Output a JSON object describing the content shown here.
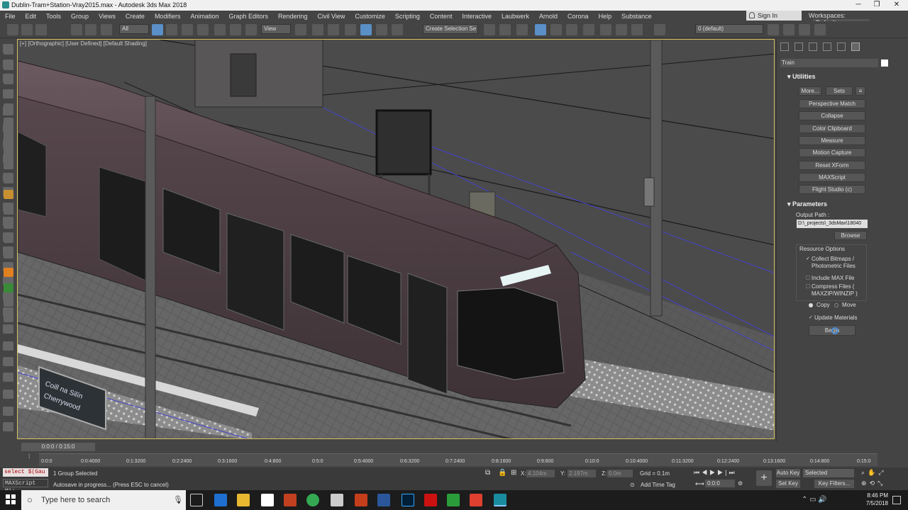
{
  "title": "Dublin-Tram+Station-Vray2015.max - Autodesk 3ds Max 2018",
  "menu": [
    "File",
    "Edit",
    "Tools",
    "Group",
    "Views",
    "Create",
    "Modifiers",
    "Animation",
    "Graph Editors",
    "Rendering",
    "Civil View",
    "Customize",
    "Scripting",
    "Content",
    "Interactive",
    "Laubwerk",
    "Arnold",
    "Corona",
    "Help",
    "Substance"
  ],
  "signin": "Sign In",
  "workspace_label": "Workspaces:",
  "workspace_value": "Default",
  "toolbar": {
    "filter": "All",
    "refcoord": "View",
    "selset": "Create Selection Se",
    "layer": "0 (default)"
  },
  "viewport": {
    "label": "[+] [Orthographic] [User Defined] [Default Shading]"
  },
  "panel": {
    "object_name": "Train",
    "utilities_title": "Utilities",
    "more": "More...",
    "sets": "Sets",
    "buttons": [
      "Perspective Match",
      "Collapse",
      "Color Clipboard",
      "Measure",
      "Motion Capture",
      "Reset XForm",
      "MAXScript",
      "Flight Studio (c)"
    ],
    "parameters_title": "Parameters",
    "output_label": "Output Path :",
    "output_path": "D:\\_projects\\_3dsMax\\18040",
    "browse": "Browse",
    "resource_title": "Resource Options",
    "collect": "Collect Bitmaps / Photometric Files",
    "include_max": "Include MAX File",
    "compress": "Compress Files ( MAXZIP/WINZIP )",
    "copy": "Copy",
    "move": "Move",
    "update": "Update Materials",
    "begin": "Begin"
  },
  "timeline": {
    "slider": "0:0:0 / 0:15:0",
    "ticks": [
      "0:0:0",
      "0:0:4000",
      "0:1:3200",
      "0:2:2400",
      "0:3:1600",
      "0:4:800",
      "0:5:0",
      "0:5:4000",
      "0:6:3200",
      "0:7:2400",
      "0:8:1600",
      "0:9:800",
      "0:10:0",
      "0:10:4000",
      "0:11:3200",
      "0:12:2400",
      "0:13:1600",
      "0:14:800",
      "0:15:0"
    ]
  },
  "status": {
    "script1": "select $(Gau",
    "script2": "MAXScript Mi:",
    "msg1": "1 Group Selected",
    "msg2": "Autosave in progress... (Press ESC to cancel)",
    "x_label": "X:",
    "x": "4.104m",
    "y_label": "Y:",
    "y": "2.197m",
    "z_label": "Z:",
    "z": "0.0m",
    "grid": "Grid = 0.1m",
    "addtag": "Add Time Tag",
    "time": "0:0:0",
    "autokey": "Auto Key",
    "selected": "Selected",
    "setkey": "Set Key",
    "keyfilters": "Key Filters..."
  },
  "taskbar": {
    "search": "Type here to search",
    "clock_time": "8:46 PM",
    "clock_date": "7/5/2018"
  },
  "sign_text": [
    "Coill na Silín",
    "Cherrywood"
  ]
}
